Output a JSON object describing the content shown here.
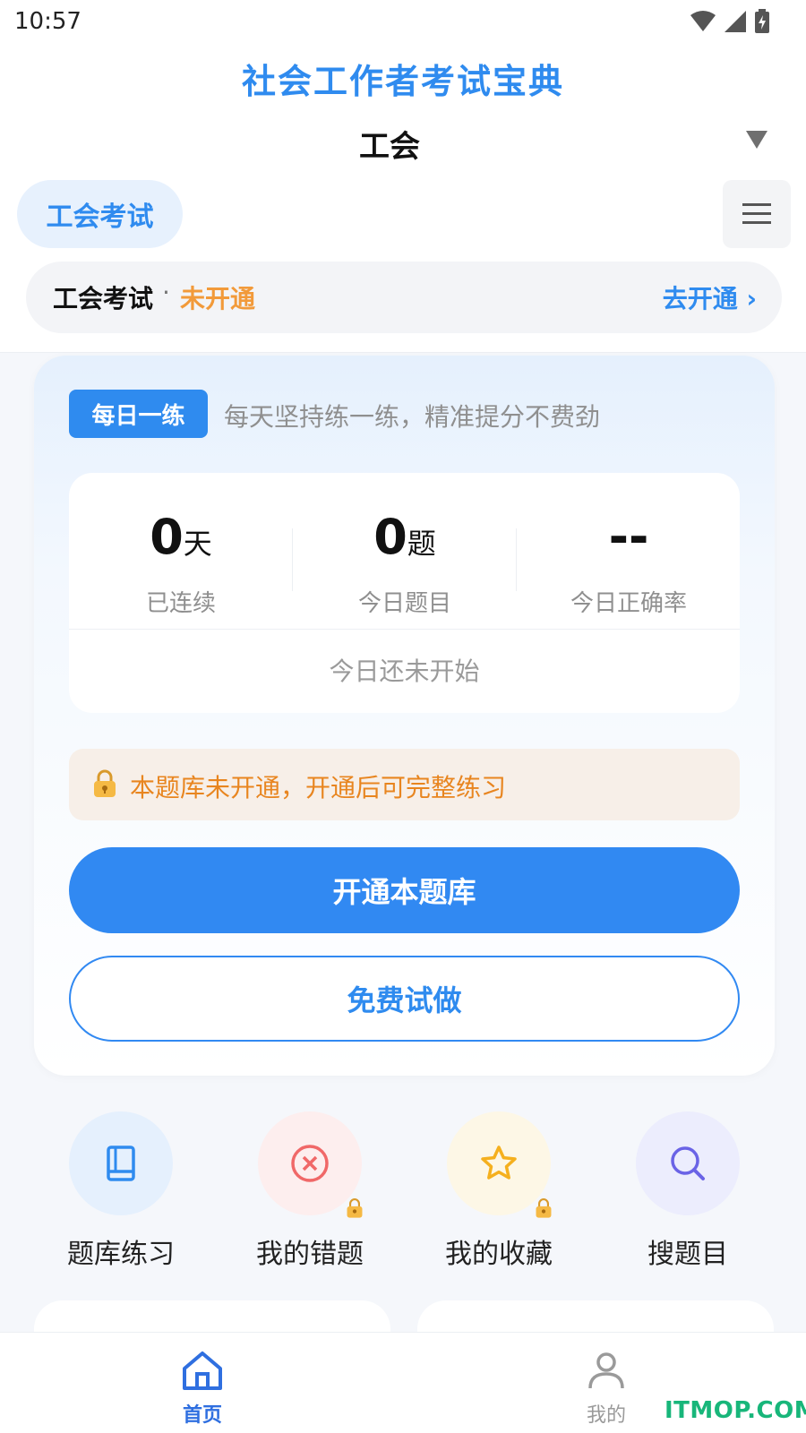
{
  "status_bar": {
    "time": "10:57"
  },
  "header": {
    "app_title": "社会工作者考试宝典",
    "category": "工会"
  },
  "tabs": [
    {
      "label": "工会考试"
    }
  ],
  "open_banner": {
    "name": "工会考试",
    "separator": "·",
    "status": "未开通",
    "action": "去开通 ›"
  },
  "daily": {
    "badge": "每日一练",
    "slogan": "每天坚持练一练，精准提分不费劲",
    "stats": [
      {
        "value": "0",
        "unit": "天",
        "label": "已连续"
      },
      {
        "value": "0",
        "unit": "题",
        "label": "今日题目"
      },
      {
        "value": "--",
        "unit": "",
        "label": "今日正确率"
      }
    ],
    "status_text": "今日还未开始",
    "lock_notice": "本题库未开通，开通后可完整练习",
    "primary_button": "开通本题库",
    "secondary_button": "免费试做"
  },
  "quick_actions": [
    {
      "label": "题库练习",
      "icon": "book-icon",
      "locked": false
    },
    {
      "label": "我的错题",
      "icon": "error-circle-icon",
      "locked": true
    },
    {
      "label": "我的收藏",
      "icon": "star-icon",
      "locked": true
    },
    {
      "label": "搜题目",
      "icon": "search-icon",
      "locked": false
    }
  ],
  "bottom_nav": [
    {
      "label": "首页",
      "icon": "home-icon",
      "active": true
    },
    {
      "label": "我的",
      "icon": "user-icon",
      "active": false
    }
  ],
  "watermark": "ITMOP.COM",
  "colors": {
    "accent": "#2f8bef",
    "warning": "#f29a3a",
    "danger": "#f06868",
    "star": "#f5b01e",
    "search": "#6a63e6"
  }
}
